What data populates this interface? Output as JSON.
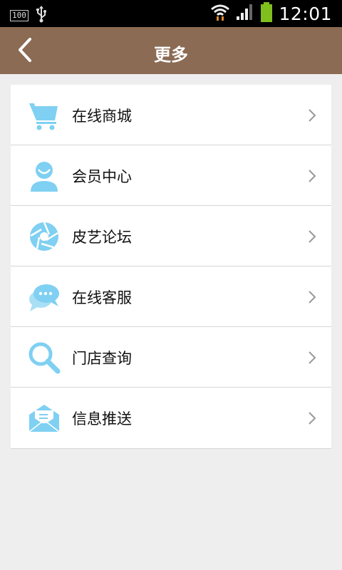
{
  "status_bar": {
    "battery_percent": "100",
    "time": "12:01",
    "icons": [
      "battery-text-icon",
      "usb-icon",
      "wifi-icon",
      "signal-icon",
      "battery-icon"
    ]
  },
  "header": {
    "title": "更多",
    "back_icon": "chevron-left-icon"
  },
  "menu": {
    "items": [
      {
        "label": "在线商城",
        "icon": "cart-icon"
      },
      {
        "label": "会员中心",
        "icon": "user-icon"
      },
      {
        "label": "皮艺论坛",
        "icon": "aperture-icon"
      },
      {
        "label": "在线客服",
        "icon": "chat-bubble-icon"
      },
      {
        "label": "门店查询",
        "icon": "search-icon"
      },
      {
        "label": "信息推送",
        "icon": "envelope-icon"
      }
    ]
  },
  "colors": {
    "header_bg": "#8b6b54",
    "icon_blue": "#7fd0f2",
    "page_bg": "#eeeeee"
  }
}
